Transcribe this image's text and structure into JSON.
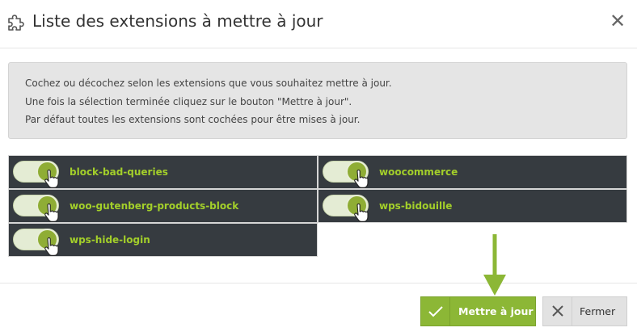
{
  "modal": {
    "title": "Liste des extensions à mettre à jour",
    "close_label": "✕"
  },
  "info": {
    "lines": [
      "Cochez ou décochez selon les extensions que vous souhaitez mettre à jour.",
      "Une fois la sélection terminée cliquez sur le bouton \"Mettre à jour\".",
      "Par défaut toutes les extensions sont cochées pour être mises à jour."
    ]
  },
  "extensions": [
    {
      "label": "block-bad-queries",
      "checked": true
    },
    {
      "label": "woocommerce",
      "checked": true
    },
    {
      "label": "woo-gutenberg-products-block",
      "checked": true
    },
    {
      "label": "wps-bidouille",
      "checked": true
    },
    {
      "label": "wps-hide-login",
      "checked": true
    }
  ],
  "footer": {
    "update_label": "Mettre à jour",
    "close_label": "Fermer"
  },
  "colors": {
    "accent": "#8cb736",
    "dark_row": "#363b40",
    "ext_text": "#a3cf2a",
    "info_bg": "#e5e5e5"
  },
  "icons": {
    "title": "puzzle-icon",
    "toggle_cursor": "hand-pointer-icon",
    "update": "check-icon",
    "close": "x-icon",
    "annotation": "down-arrow-icon"
  }
}
